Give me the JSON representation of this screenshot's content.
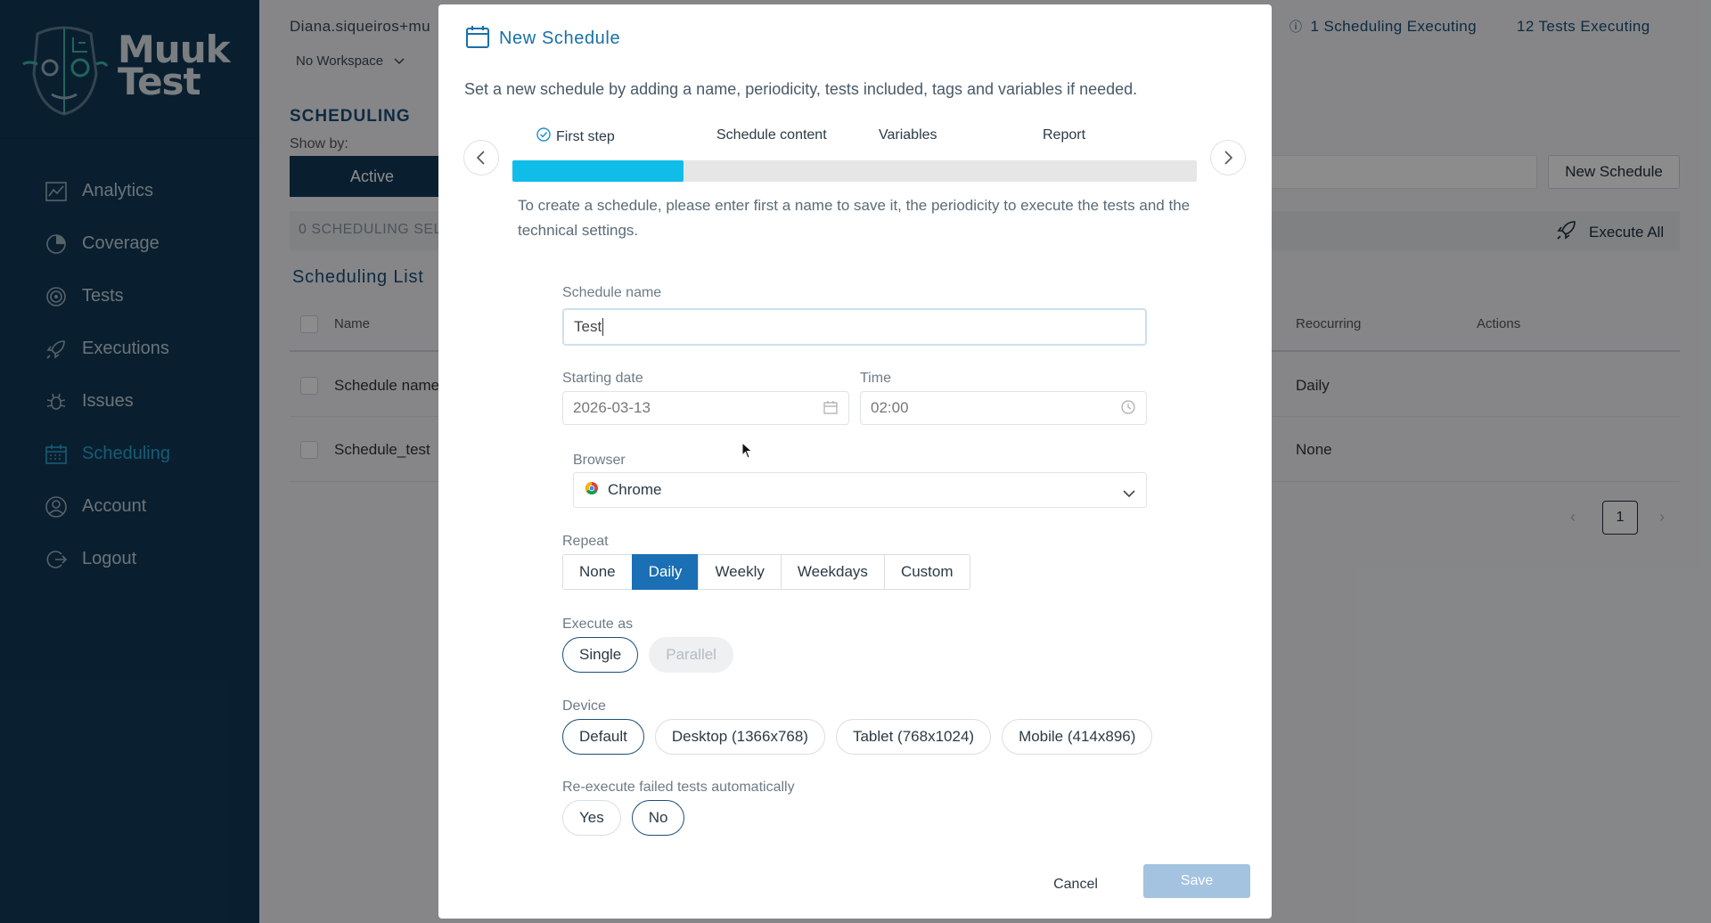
{
  "app": {
    "brand": [
      "Muuk",
      "Test"
    ],
    "user": "Diana.siqueiros+mu",
    "workspace": "No Workspace",
    "status": {
      "scheduling": "1 Scheduling Executing",
      "tests": "12 Tests Executing"
    }
  },
  "sidebar": {
    "items": [
      {
        "label": "Analytics",
        "icon": "analytics-icon"
      },
      {
        "label": "Coverage",
        "icon": "coverage-icon"
      },
      {
        "label": "Tests",
        "icon": "tests-icon"
      },
      {
        "label": "Executions",
        "icon": "rocket-icon"
      },
      {
        "label": "Issues",
        "icon": "bug-icon"
      },
      {
        "label": "Scheduling",
        "icon": "calendar-icon",
        "active": true
      },
      {
        "label": "Account",
        "icon": "user-icon"
      },
      {
        "label": "Logout",
        "icon": "logout-icon"
      }
    ],
    "active_color": "#2aa6d8"
  },
  "background": {
    "page_title": "SCHEDULING",
    "show_by": "Show by:",
    "active_tab": "Active",
    "selected_count": "0 SCHEDULING SEL",
    "new_schedule": "New Schedule",
    "execute_all": "Execute All",
    "list_title": "Scheduling List",
    "columns": {
      "name": "Name",
      "recurring": "Reocurring",
      "actions": "Actions"
    },
    "rows": [
      {
        "name": "Schedule name",
        "recurring": "Daily"
      },
      {
        "name": "Schedule_test",
        "recurring": "None"
      }
    ],
    "page": "1"
  },
  "modal": {
    "title": "New Schedule",
    "description": "Set a new schedule by adding a name, periodicity, tests included, tags and variables if needed.",
    "steps": [
      "First step",
      "Schedule content",
      "Variables",
      "Report"
    ],
    "progress_fraction": 0.25,
    "step_help": "To create a schedule, please enter first a name to save it, the periodicity to execute the tests and the technical settings.",
    "schedule_name": {
      "label": "Schedule name",
      "value": "Test"
    },
    "starting_date": {
      "label": "Starting date",
      "value": "2026-03-13"
    },
    "time": {
      "label": "Time",
      "value": "02:00"
    },
    "browser": {
      "label": "Browser",
      "value": "Chrome"
    },
    "repeat": {
      "label": "Repeat",
      "options": [
        "None",
        "Daily",
        "Weekly",
        "Weekdays",
        "Custom"
      ],
      "selected": "Daily"
    },
    "execute_as": {
      "label": "Execute as",
      "options": [
        "Single",
        "Parallel"
      ],
      "selected": "Single",
      "disabled": "Parallel"
    },
    "device": {
      "label": "Device",
      "options": [
        "Default",
        "Desktop (1366x768)",
        "Tablet (768x1024)",
        "Mobile (414x896)"
      ],
      "selected": "Default"
    },
    "reexecute": {
      "label": "Re-execute failed tests automatically",
      "options": [
        "Yes",
        "No"
      ],
      "selected": "No"
    },
    "cancel": "Cancel",
    "save": "Save",
    "accent": "#1a6fb5",
    "progress_color": "#0fbde8"
  }
}
